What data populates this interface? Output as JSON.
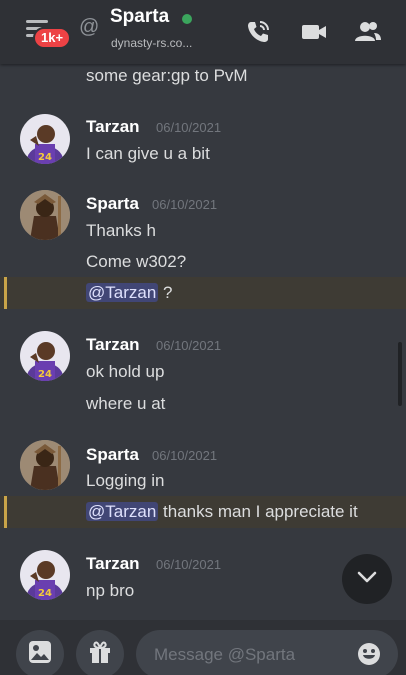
{
  "header": {
    "badge": "1k+",
    "title": "Sparta",
    "subtitle": "dynasty-rs.co...",
    "icons": [
      "menu-icon",
      "at-icon",
      "phone-call-icon",
      "video-camera-icon",
      "members-icon"
    ],
    "online_color": "#3ba55d"
  },
  "messages": {
    "m0": {
      "text": "some gear:gp to PvM"
    },
    "g1": {
      "author": "Tarzan",
      "timestamp": "06/10/2021",
      "lines": [
        "I can give u a bit"
      ]
    },
    "g2": {
      "author": "Sparta",
      "timestamp": "06/10/2021",
      "lines": [
        "Thanks h",
        "Come w302?"
      ],
      "mention": "@Tarzan",
      "mention_rest": " ?"
    },
    "g3": {
      "author": "Tarzan",
      "timestamp": "06/10/2021",
      "lines": [
        "ok hold up",
        "where u at"
      ]
    },
    "g4": {
      "author": "Sparta",
      "timestamp": "06/10/2021",
      "lines": [
        "Logging in"
      ],
      "mention": "@Tarzan",
      "mention_rest": " thanks man I appreciate it"
    },
    "g5": {
      "author": "Tarzan",
      "timestamp": "06/10/2021",
      "lines": [
        "np bro"
      ]
    }
  },
  "composer": {
    "placeholder": "Message @Sparta",
    "icons": [
      "image-icon",
      "gift-icon",
      "emoji-icon"
    ]
  },
  "colors": {
    "background": "#36393f",
    "header": "#2f3136",
    "mention_highlight": "#3e3b34",
    "mention_bar": "#c9a449",
    "badge": "#ed4245"
  }
}
